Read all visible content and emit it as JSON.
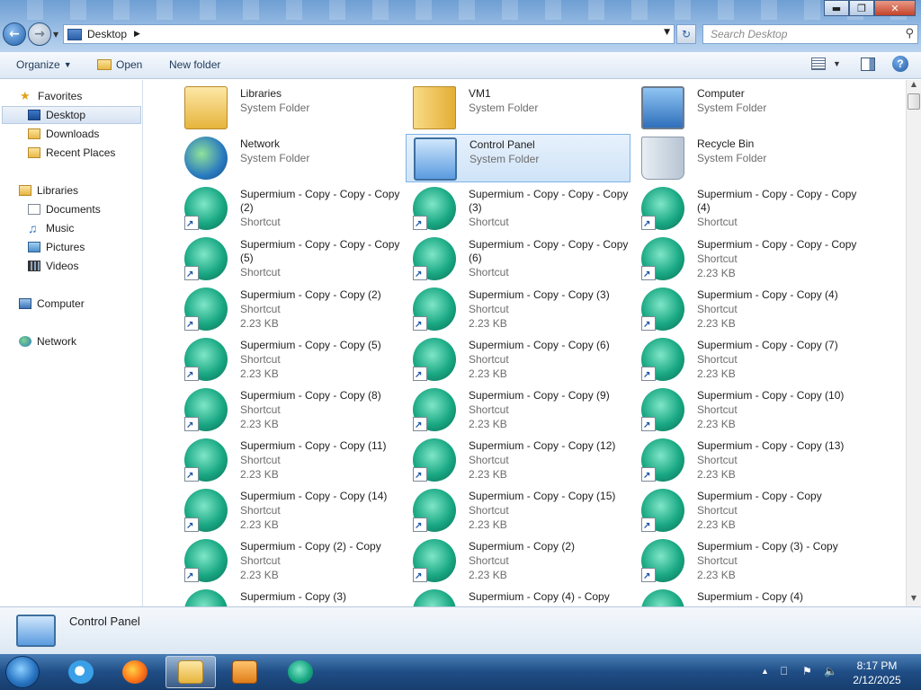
{
  "window": {
    "controls": {
      "minimize": "▬",
      "maximize": "❐",
      "close": "✕"
    }
  },
  "address": {
    "path": "Desktop",
    "search_placeholder": "Search Desktop"
  },
  "toolbar": {
    "organize": "Organize",
    "open": "Open",
    "new_folder": "New folder"
  },
  "sidebar": {
    "favorites": "Favorites",
    "desktop": "Desktop",
    "downloads": "Downloads",
    "recent_places": "Recent Places",
    "libraries": "Libraries",
    "documents": "Documents",
    "music": "Music",
    "pictures": "Pictures",
    "videos": "Videos",
    "computer": "Computer",
    "network": "Network"
  },
  "items": [
    {
      "name": "Libraries",
      "type": "System Folder",
      "size": "",
      "icon": "libraries-icon"
    },
    {
      "name": "VM1",
      "type": "System Folder",
      "size": "",
      "icon": "user-folder-icon"
    },
    {
      "name": "Computer",
      "type": "System Folder",
      "size": "",
      "icon": "computer-icon"
    },
    {
      "name": "Network",
      "type": "System Folder",
      "size": "",
      "icon": "network-icon"
    },
    {
      "name": "Control Panel",
      "type": "System Folder",
      "size": "",
      "icon": "control-panel-icon",
      "selected": true
    },
    {
      "name": "Recycle Bin",
      "type": "System Folder",
      "size": "",
      "icon": "recycle-bin-icon"
    },
    {
      "name": "Supermium - Copy - Copy - Copy (2)",
      "type": "Shortcut",
      "size": "",
      "icon": "supermium-shortcut-icon"
    },
    {
      "name": "Supermium - Copy - Copy - Copy (3)",
      "type": "Shortcut",
      "size": "",
      "icon": "supermium-shortcut-icon"
    },
    {
      "name": "Supermium - Copy - Copy - Copy (4)",
      "type": "Shortcut",
      "size": "",
      "icon": "supermium-shortcut-icon"
    },
    {
      "name": "Supermium - Copy - Copy - Copy (5)",
      "type": "Shortcut",
      "size": "",
      "icon": "supermium-shortcut-icon"
    },
    {
      "name": "Supermium - Copy - Copy - Copy (6)",
      "type": "Shortcut",
      "size": "",
      "icon": "supermium-shortcut-icon"
    },
    {
      "name": "Supermium - Copy - Copy - Copy",
      "type": "Shortcut",
      "size": "2.23 KB",
      "icon": "supermium-shortcut-icon"
    },
    {
      "name": "Supermium - Copy - Copy (2)",
      "type": "Shortcut",
      "size": "2.23 KB",
      "icon": "supermium-shortcut-icon"
    },
    {
      "name": "Supermium - Copy - Copy (3)",
      "type": "Shortcut",
      "size": "2.23 KB",
      "icon": "supermium-shortcut-icon"
    },
    {
      "name": "Supermium - Copy - Copy (4)",
      "type": "Shortcut",
      "size": "2.23 KB",
      "icon": "supermium-shortcut-icon"
    },
    {
      "name": "Supermium - Copy - Copy (5)",
      "type": "Shortcut",
      "size": "2.23 KB",
      "icon": "supermium-shortcut-icon"
    },
    {
      "name": "Supermium - Copy - Copy (6)",
      "type": "Shortcut",
      "size": "2.23 KB",
      "icon": "supermium-shortcut-icon"
    },
    {
      "name": "Supermium - Copy - Copy (7)",
      "type": "Shortcut",
      "size": "2.23 KB",
      "icon": "supermium-shortcut-icon"
    },
    {
      "name": "Supermium - Copy - Copy (8)",
      "type": "Shortcut",
      "size": "2.23 KB",
      "icon": "supermium-shortcut-icon"
    },
    {
      "name": "Supermium - Copy - Copy (9)",
      "type": "Shortcut",
      "size": "2.23 KB",
      "icon": "supermium-shortcut-icon"
    },
    {
      "name": "Supermium - Copy - Copy (10)",
      "type": "Shortcut",
      "size": "2.23 KB",
      "icon": "supermium-shortcut-icon"
    },
    {
      "name": "Supermium - Copy - Copy (11)",
      "type": "Shortcut",
      "size": "2.23 KB",
      "icon": "supermium-shortcut-icon"
    },
    {
      "name": "Supermium - Copy - Copy (12)",
      "type": "Shortcut",
      "size": "2.23 KB",
      "icon": "supermium-shortcut-icon"
    },
    {
      "name": "Supermium - Copy - Copy (13)",
      "type": "Shortcut",
      "size": "2.23 KB",
      "icon": "supermium-shortcut-icon"
    },
    {
      "name": "Supermium - Copy - Copy (14)",
      "type": "Shortcut",
      "size": "2.23 KB",
      "icon": "supermium-shortcut-icon"
    },
    {
      "name": "Supermium - Copy - Copy (15)",
      "type": "Shortcut",
      "size": "2.23 KB",
      "icon": "supermium-shortcut-icon"
    },
    {
      "name": "Supermium - Copy - Copy",
      "type": "Shortcut",
      "size": "2.23 KB",
      "icon": "supermium-shortcut-icon"
    },
    {
      "name": "Supermium - Copy (2) - Copy",
      "type": "Shortcut",
      "size": "2.23 KB",
      "icon": "supermium-shortcut-icon"
    },
    {
      "name": "Supermium - Copy (2)",
      "type": "Shortcut",
      "size": "2.23 KB",
      "icon": "supermium-shortcut-icon"
    },
    {
      "name": "Supermium - Copy (3) - Copy",
      "type": "Shortcut",
      "size": "2.23 KB",
      "icon": "supermium-shortcut-icon"
    },
    {
      "name": "Supermium - Copy (3)",
      "type": "",
      "size": "",
      "icon": "supermium-shortcut-icon"
    },
    {
      "name": "Supermium - Copy (4) - Copy",
      "type": "",
      "size": "",
      "icon": "supermium-shortcut-icon"
    },
    {
      "name": "Supermium - Copy (4)",
      "type": "",
      "size": "",
      "icon": "supermium-shortcut-icon"
    }
  ],
  "details": {
    "name": "Control Panel"
  },
  "tray": {
    "time": "8:17 PM",
    "date": "2/12/2025"
  }
}
